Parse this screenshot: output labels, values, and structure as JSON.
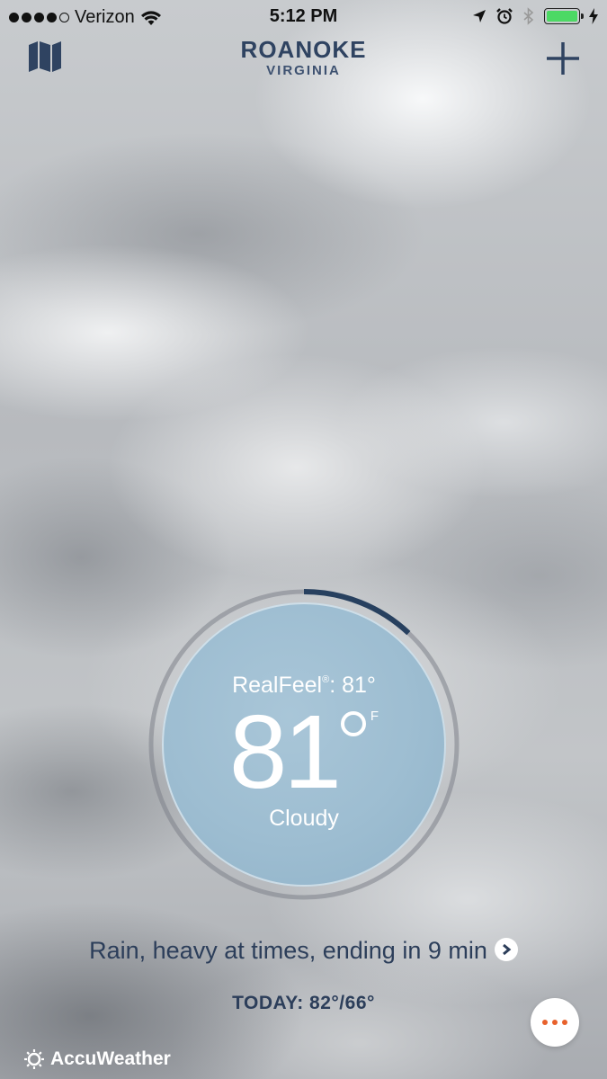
{
  "status_bar": {
    "carrier": "Verizon",
    "signal_bars_filled": 4,
    "signal_bars_total": 5,
    "time": "5:12 PM",
    "battery_level": 1.0,
    "battery_color": "#4cd964"
  },
  "header": {
    "city": "ROANOKE",
    "state": "VIRGINIA",
    "left_icon": "map-icon",
    "right_icon": "plus-icon"
  },
  "current": {
    "realfeel_label": "RealFeel",
    "realfeel_mark": "®",
    "realfeel_value": ": 81°",
    "temperature": "81",
    "unit": "F",
    "condition": "Cloudy",
    "ring_progress": 0.12
  },
  "forecast": {
    "minute_cast": "Rain, heavy at times, ending in 9 min",
    "today": "TODAY: 82°/66°"
  },
  "footer": {
    "brand": "AccuWeather",
    "more_icon": "more-dots-icon"
  },
  "colors": {
    "navy": "#2f4361",
    "accent_orange": "#e8612c",
    "ring_progress": "#27405f"
  }
}
